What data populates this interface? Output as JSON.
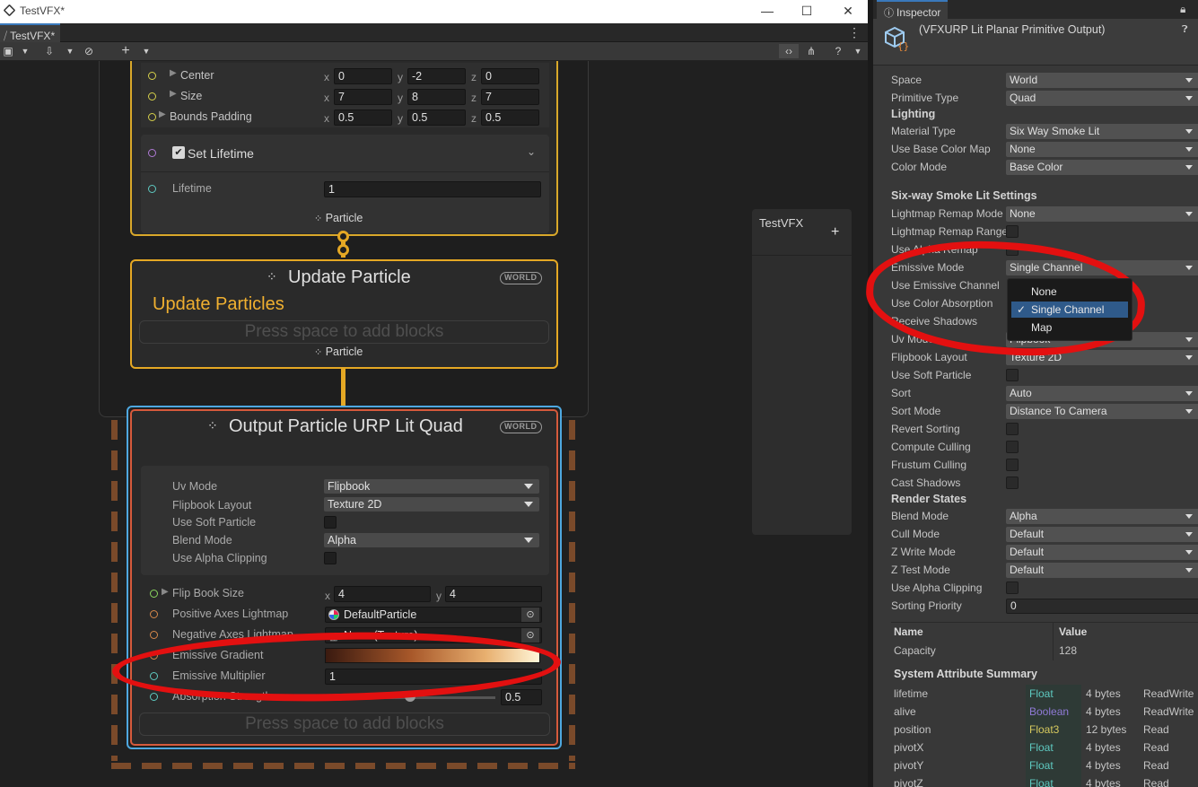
{
  "window": {
    "title": "TestVFX*",
    "tab": "TestVFX*",
    "controls": {
      "minimize": "—",
      "maximize": "☐",
      "close": "✕"
    }
  },
  "toolbar": {
    "save_icon": "save-icon",
    "add_label": "+",
    "help_icon": "help-icon"
  },
  "graph": {
    "spawn_node": {
      "rows": [
        {
          "label": "Center",
          "x": "0",
          "y": "-2",
          "z": "0"
        },
        {
          "label": "Size",
          "x": "7",
          "y": "8",
          "z": "7"
        },
        {
          "label": "Bounds Padding",
          "x": "0.5",
          "y": "0.5",
          "z": "0.5"
        }
      ],
      "set_lifetime_title": "Set Lifetime",
      "lifetime_label": "Lifetime",
      "lifetime_value": "1",
      "footer": "Particle"
    },
    "update_node": {
      "title": "Update Particle",
      "badge": "WORLD",
      "subtitle": "Update Particles",
      "press_space": "Press space to add blocks",
      "footer": "Particle"
    },
    "output_node": {
      "title": "Output Particle URP Lit Quad",
      "badge": "WORLD",
      "settings": [
        {
          "label": "Uv Mode",
          "value": "Flipbook",
          "type": "dropdown"
        },
        {
          "label": "Flipbook Layout",
          "value": "Texture 2D",
          "type": "dropdown"
        },
        {
          "label": "Use Soft Particle",
          "type": "checkbox"
        },
        {
          "label": "Blend Mode",
          "value": "Alpha",
          "type": "dropdown"
        },
        {
          "label": "Use Alpha Clipping",
          "type": "checkbox"
        }
      ],
      "flip_book_size": {
        "label": "Flip Book Size",
        "x": "4",
        "y": "4"
      },
      "positive_axes": {
        "label": "Positive Axes Lightmap",
        "value": "DefaultParticle"
      },
      "negative_axes": {
        "label": "Negative Axes Lightmap",
        "value": "None (Texture)"
      },
      "emissive_gradient": {
        "label": "Emissive Gradient"
      },
      "emissive_multiplier": {
        "label": "Emissive Multiplier",
        "value": "1"
      },
      "absorption_strength": {
        "label": "Absorption Strength",
        "value": "0.5",
        "level": 0.5
      },
      "press_space": "Press space to add blocks"
    },
    "blackboard": {
      "title": "TestVFX",
      "add": "+"
    }
  },
  "inspector": {
    "tab": "Inspector",
    "object_title": "(VFXURP Lit Planar Primitive Output)",
    "rows": [
      {
        "label": "Space",
        "value": "World",
        "type": "dropdown"
      },
      {
        "label": "Primitive Type",
        "value": "Quad",
        "type": "dropdown"
      },
      {
        "label": "Lighting",
        "type": "header"
      },
      {
        "label": "Material Type",
        "value": "Six Way Smoke Lit",
        "type": "dropdown"
      },
      {
        "label": "Use Base Color Map",
        "value": "None",
        "type": "dropdown"
      },
      {
        "label": "Color Mode",
        "value": "Base Color",
        "type": "dropdown"
      },
      {
        "label": "Six-way Smoke Lit Settings",
        "type": "header"
      },
      {
        "label": "Lightmap Remap Mode",
        "value": "None",
        "type": "dropdown"
      },
      {
        "label": "Lightmap Remap Range",
        "type": "checkbox"
      },
      {
        "label": "Use Alpha Remap",
        "type": "checkbox"
      },
      {
        "label": "Emissive Mode",
        "value": "Single Channel",
        "type": "dropdown"
      },
      {
        "label": "Use Emissive Channel",
        "type": "none"
      },
      {
        "label": "Use Color Absorption",
        "type": "none"
      },
      {
        "label": "Receive Shadows",
        "type": "none"
      },
      {
        "label": "Uv Mode",
        "value": "Flipbook",
        "type": "dropdown"
      },
      {
        "label": "Flipbook Layout",
        "value": "Texture 2D",
        "type": "dropdown"
      },
      {
        "label": "Use Soft Particle",
        "type": "checkbox"
      },
      {
        "label": "Sort",
        "value": "Auto",
        "type": "dropdown"
      },
      {
        "label": "Sort Mode",
        "value": "Distance To Camera",
        "type": "dropdown"
      },
      {
        "label": "Revert Sorting",
        "type": "checkbox"
      },
      {
        "label": "Compute Culling",
        "type": "checkbox"
      },
      {
        "label": "Frustum Culling",
        "type": "checkbox"
      },
      {
        "label": "Cast Shadows",
        "type": "checkbox"
      },
      {
        "label": "Render States",
        "type": "header"
      },
      {
        "label": "Blend Mode",
        "value": "Alpha",
        "type": "dropdown"
      },
      {
        "label": "Cull Mode",
        "value": "Default",
        "type": "dropdown"
      },
      {
        "label": "Z Write Mode",
        "value": "Default",
        "type": "dropdown"
      },
      {
        "label": "Z Test Mode",
        "value": "Default",
        "type": "dropdown"
      },
      {
        "label": "Use Alpha Clipping",
        "type": "checkbox"
      },
      {
        "label": "Sorting Priority",
        "value": "0",
        "type": "field"
      }
    ],
    "capacity_table": {
      "col_name": "Name",
      "col_value": "Value",
      "name": "Capacity",
      "value": "128"
    },
    "attr_summary": {
      "title": "System Attribute Summary",
      "rows": [
        {
          "name": "lifetime",
          "type": "Float",
          "size": "4 bytes",
          "access": "ReadWrite",
          "color": "#5ec9c0"
        },
        {
          "name": "alive",
          "type": "Boolean",
          "size": "4 bytes",
          "access": "ReadWrite",
          "color": "#8f7ad6"
        },
        {
          "name": "position",
          "type": "Float3",
          "size": "12 bytes",
          "access": "Read",
          "color": "#d6c95e"
        },
        {
          "name": "pivotX",
          "type": "Float",
          "size": "4 bytes",
          "access": "Read",
          "color": "#5ec9c0"
        },
        {
          "name": "pivotY",
          "type": "Float",
          "size": "4 bytes",
          "access": "Read",
          "color": "#5ec9c0"
        },
        {
          "name": "pivotZ",
          "type": "Float",
          "size": "4 bytes",
          "access": "Read",
          "color": "#5ec9c0"
        }
      ]
    },
    "popup": {
      "items": [
        {
          "label": "None",
          "selected": false
        },
        {
          "label": "Single Channel",
          "selected": true
        },
        {
          "label": "Map",
          "selected": false
        }
      ],
      "checkmark": "✓"
    }
  },
  "colors": {
    "spawn_border": "#d9a82a",
    "update_border": "#e5a824",
    "output_border": "#4ea8e0",
    "output_inner": "#d65a3c",
    "highlight": "#e31010",
    "selection": "#2f5a8a"
  }
}
